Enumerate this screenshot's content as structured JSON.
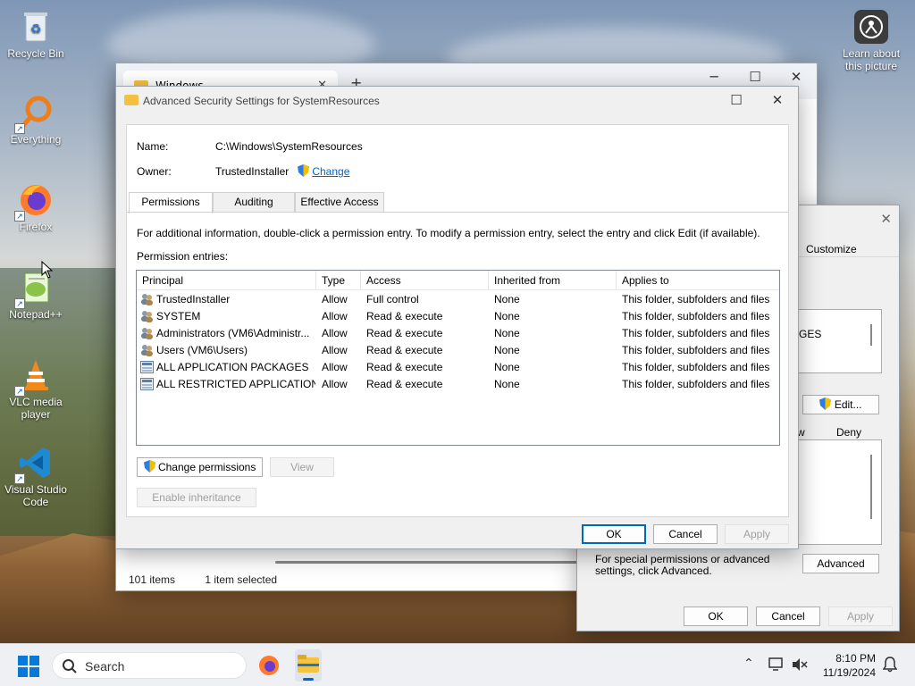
{
  "desktop": {
    "icons": [
      {
        "label": "Recycle Bin"
      },
      {
        "label": "Everything"
      },
      {
        "label": "Firefox"
      },
      {
        "label": "Notepad++"
      },
      {
        "label": "VLC media player"
      },
      {
        "label": "Visual Studio Code"
      }
    ],
    "learn_about": "Learn about this picture"
  },
  "explorer": {
    "tab_title": "Windows",
    "status_items": "101 items",
    "status_selected": "1 item selected"
  },
  "properties": {
    "tab_customize": "Customize",
    "list_fragment": "GES",
    "edit_button": "Edit...",
    "col_allow_fragment": "w",
    "col_deny": "Deny",
    "special_text": "For special permissions or advanced settings, click Advanced.",
    "advanced_button": "Advanced",
    "ok": "OK",
    "cancel": "Cancel",
    "apply": "Apply"
  },
  "advanced": {
    "title": "Advanced Security Settings for SystemResources",
    "name_label": "Name:",
    "name_value": "C:\\Windows\\SystemResources",
    "owner_label": "Owner:",
    "owner_value": "TrustedInstaller",
    "change_link": "Change",
    "tabs": [
      "Permissions",
      "Auditing",
      "Effective Access"
    ],
    "info_text": "For additional information, double-click a permission entry. To modify a permission entry, select the entry and click Edit (if available).",
    "entries_label": "Permission entries:",
    "columns": [
      "Principal",
      "Type",
      "Access",
      "Inherited from",
      "Applies to"
    ],
    "rows": [
      {
        "principal": "TrustedInstaller",
        "type": "Allow",
        "access": "Full control",
        "inherited": "None",
        "applies": "This folder, subfolders and files",
        "icon": "users-icon"
      },
      {
        "principal": "SYSTEM",
        "type": "Allow",
        "access": "Read & execute",
        "inherited": "None",
        "applies": "This folder, subfolders and files",
        "icon": "users-icon"
      },
      {
        "principal": "Administrators (VM6\\Administr...",
        "type": "Allow",
        "access": "Read & execute",
        "inherited": "None",
        "applies": "This folder, subfolders and files",
        "icon": "users-icon"
      },
      {
        "principal": "Users (VM6\\Users)",
        "type": "Allow",
        "access": "Read & execute",
        "inherited": "None",
        "applies": "This folder, subfolders and files",
        "icon": "users-icon"
      },
      {
        "principal": "ALL APPLICATION PACKAGES",
        "type": "Allow",
        "access": "Read & execute",
        "inherited": "None",
        "applies": "This folder, subfolders and files",
        "icon": "package-icon"
      },
      {
        "principal": "ALL RESTRICTED APPLICATION ...",
        "type": "Allow",
        "access": "Read & execute",
        "inherited": "None",
        "applies": "This folder, subfolders and files",
        "icon": "package-icon"
      }
    ],
    "change_permissions": "Change permissions",
    "view": "View",
    "enable_inheritance": "Enable inheritance",
    "ok": "OK",
    "cancel": "Cancel",
    "apply": "Apply"
  },
  "taskbar": {
    "search_placeholder": "Search",
    "time": "8:10 PM",
    "date": "11/19/2024"
  },
  "colors": {
    "accent": "#0067c0",
    "link": "#0563c1"
  }
}
